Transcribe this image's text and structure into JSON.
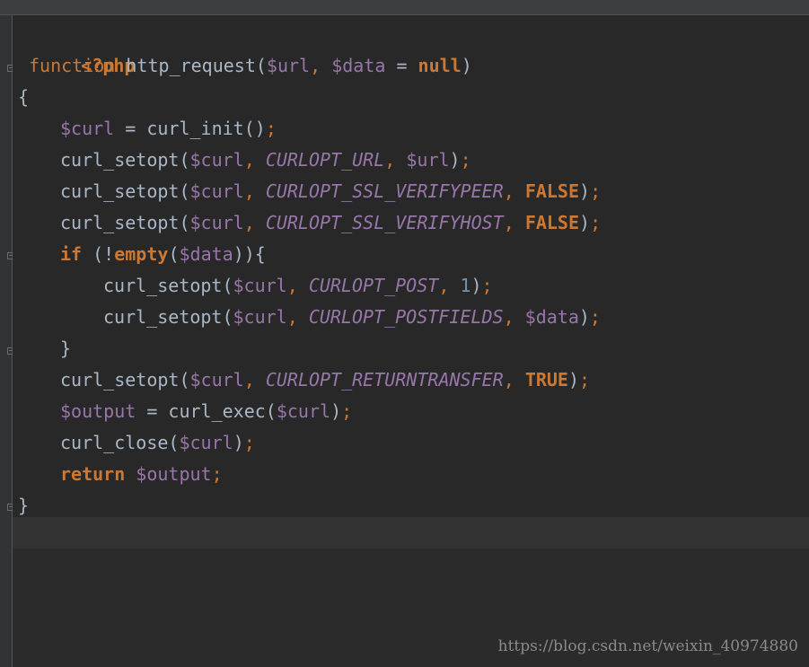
{
  "editor": {
    "language": "php",
    "colors": {
      "background": "#2b2b2b",
      "keyword": "#cc7832",
      "variable": "#9876aa",
      "constant": "#9876aa",
      "number": "#6897bb",
      "plain": "#a9b7c6"
    },
    "lines": [
      {
        "tokens": [
          "<?php"
        ]
      },
      {
        "tokens": [
          "function",
          " ",
          "http_request",
          "(",
          "$url",
          ", ",
          "$data",
          " = ",
          "null",
          ")"
        ]
      },
      {
        "tokens": [
          "{"
        ]
      },
      {
        "tokens": [
          "$curl",
          " = ",
          "curl_init",
          "()",
          ";"
        ]
      },
      {
        "tokens": [
          "curl_setopt",
          "(",
          "$curl",
          ", ",
          "CURLOPT_URL",
          ", ",
          "$url",
          ")",
          ";"
        ]
      },
      {
        "tokens": [
          "curl_setopt",
          "(",
          "$curl",
          ", ",
          "CURLOPT_SSL_VERIFYPEER",
          ", ",
          "FALSE",
          ")",
          ";"
        ]
      },
      {
        "tokens": [
          "curl_setopt",
          "(",
          "$curl",
          ", ",
          "CURLOPT_SSL_VERIFYHOST",
          ", ",
          "FALSE",
          ")",
          ";"
        ]
      },
      {
        "tokens": [
          "if",
          " (!",
          "empty",
          "(",
          "$data",
          ")){"
        ]
      },
      {
        "tokens": [
          "curl_setopt",
          "(",
          "$curl",
          ", ",
          "CURLOPT_POST",
          ", ",
          "1",
          ")",
          ";"
        ]
      },
      {
        "tokens": [
          "curl_setopt",
          "(",
          "$curl",
          ", ",
          "CURLOPT_POSTFIELDS",
          ", ",
          "$data",
          ")",
          ";"
        ]
      },
      {
        "tokens": [
          "}"
        ]
      },
      {
        "tokens": [
          "curl_setopt",
          "(",
          "$curl",
          ", ",
          "CURLOPT_RETURNTRANSFER",
          ", ",
          "TRUE",
          ")",
          ";"
        ]
      },
      {
        "tokens": [
          "$output",
          " = ",
          "curl_exec",
          "(",
          "$curl",
          ")",
          ";"
        ]
      },
      {
        "tokens": [
          "curl_close",
          "(",
          "$curl",
          ")",
          ";"
        ]
      },
      {
        "tokens": [
          "return",
          " ",
          "$output",
          ";"
        ]
      },
      {
        "tokens": [
          "}"
        ]
      }
    ]
  },
  "watermark": "https://blog.csdn.net/weixin_40974880"
}
